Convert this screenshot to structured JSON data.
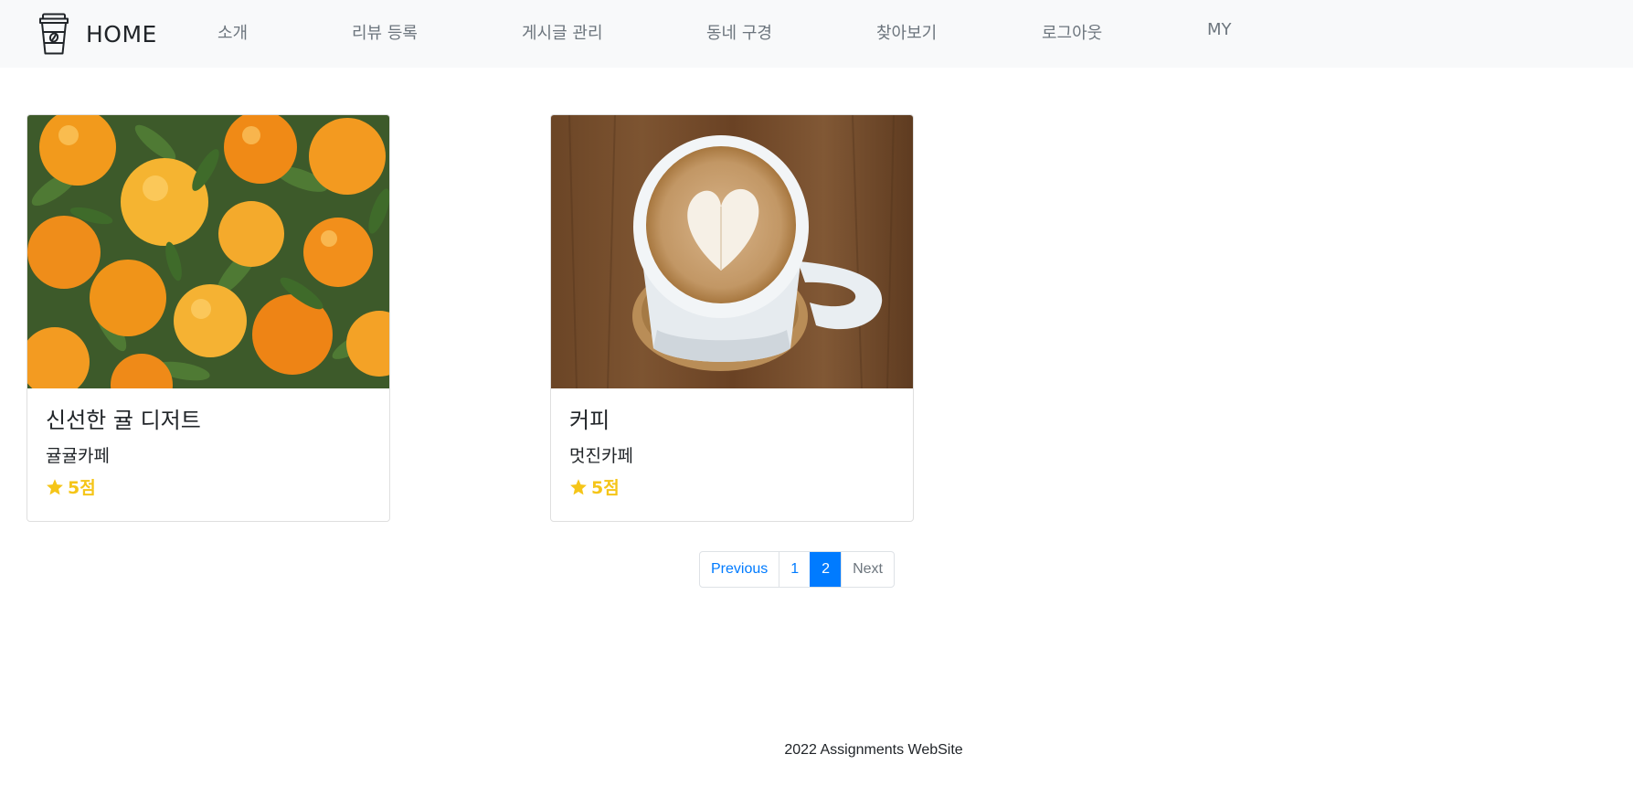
{
  "navbar": {
    "brand": "HOME",
    "items": [
      {
        "label": "소개"
      },
      {
        "label": "리뷰 등록"
      },
      {
        "label": "게시글 관리"
      },
      {
        "label": "동네 구경"
      },
      {
        "label": "찾아보기"
      },
      {
        "label": "로그아웃"
      },
      {
        "label": "MY"
      }
    ]
  },
  "cards": [
    {
      "title": "신선한 귤 디저트",
      "subtitle": "귤귤카페",
      "rating": "5점",
      "image": "oranges-photo"
    },
    {
      "title": "커피",
      "subtitle": "멋진카페",
      "rating": "5점",
      "image": "latte-photo"
    }
  ],
  "pagination": {
    "previous": "Previous",
    "pages": [
      "1",
      "2"
    ],
    "active_page": "2",
    "next": "Next"
  },
  "footer": {
    "text": "2022 Assignments WebSite"
  },
  "colors": {
    "navbar_bg": "#f8f9fa",
    "link": "#007bff",
    "rating": "#f5c518",
    "muted": "#6c757d"
  }
}
